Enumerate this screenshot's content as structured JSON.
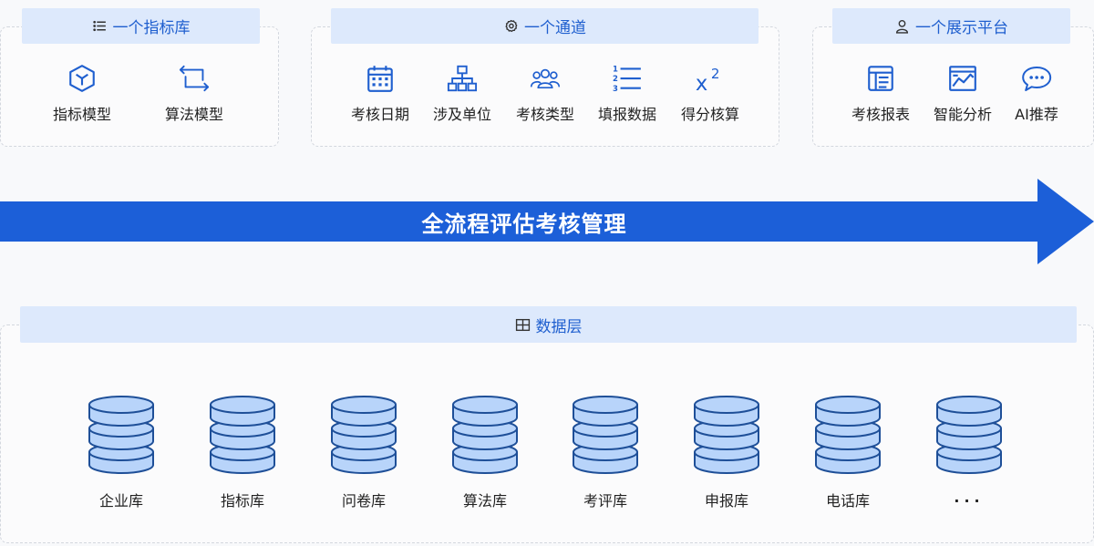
{
  "panels": {
    "indicator": {
      "title": "一个指标库",
      "items": [
        {
          "label": "指标模型",
          "icon": "cube-icon"
        },
        {
          "label": "算法模型",
          "icon": "loop-arrows-icon"
        }
      ]
    },
    "channel": {
      "title": "一个通道",
      "items": [
        {
          "label": "考核日期",
          "icon": "calendar-icon"
        },
        {
          "label": "涉及单位",
          "icon": "org-chart-icon"
        },
        {
          "label": "考核类型",
          "icon": "people-icon"
        },
        {
          "label": "填报数据",
          "icon": "numbered-list-icon"
        },
        {
          "label": "得分核算",
          "icon": "superscript-icon"
        }
      ]
    },
    "display": {
      "title": "一个展示平台",
      "items": [
        {
          "label": "考核报表",
          "icon": "report-icon"
        },
        {
          "label": "智能分析",
          "icon": "chart-window-icon"
        },
        {
          "label": "AI推荐",
          "icon": "chat-bubble-icon"
        }
      ]
    }
  },
  "arrow": {
    "title": "全流程评估考核管理",
    "color": "#1c5fd8"
  },
  "data_layer": {
    "title": "数据层",
    "databases": [
      "企业库",
      "指标库",
      "问卷库",
      "算法库",
      "考评库",
      "申报库",
      "电话库",
      "..."
    ]
  },
  "colors": {
    "accent": "#1f5fcf",
    "header_bg": "#dde9fc",
    "db_fill": "#b8d4fa",
    "db_stroke": "#1e4f98"
  }
}
